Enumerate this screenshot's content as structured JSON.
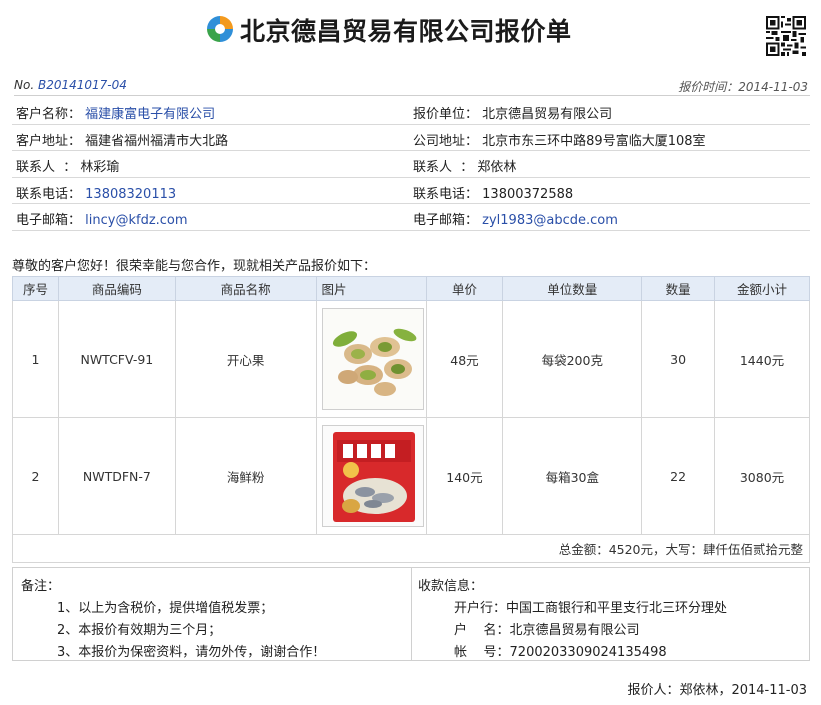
{
  "document": {
    "title": "北京德昌贸易有限公司报价单",
    "quote_no_label": "No.",
    "quote_no": "B20141017-04",
    "quote_date_label": "报价时间：",
    "quote_date": "2014-11-03"
  },
  "client": {
    "name_label": "客户名称：",
    "name": "福建康富电子有限公司",
    "address_label": "客户地址：",
    "address": "福建省福州福清市大北路",
    "contact_label": "联系人  ：",
    "contact": "林彩瑜",
    "phone_label": "联系电话：",
    "phone": "13808320113",
    "email_label": "电子邮箱：",
    "email": "lincy@kfdz.com"
  },
  "supplier": {
    "unit_label": "报价单位：",
    "unit": "北京德昌贸易有限公司",
    "address_label": "公司地址：",
    "address": "北京市东三环中路89号富临大厦108室",
    "contact_label": "联系人  ：",
    "contact": "郑依林",
    "phone_label": "联系电话：",
    "phone": "13800372588",
    "email_label": "电子邮箱：",
    "email": "zyl1983@abcde.com"
  },
  "greeting": "尊敬的客户您好！很荣幸能与您合作，现就相关产品报价如下：",
  "table": {
    "headers": [
      "序号",
      "商品编码",
      "商品名称",
      "图片",
      "单价",
      "单位数量",
      "数量",
      "金额小计"
    ],
    "rows": [
      {
        "no": "1",
        "code": "NWTCFV-91",
        "name": "开心果",
        "image": "pistachio-photo",
        "price": "48元",
        "unit_qty": "每袋200克",
        "qty": "30",
        "subtotal": "1440元"
      },
      {
        "no": "2",
        "code": "NWTDFN-7",
        "name": "海鲜粉",
        "image": "seafood-powder-package",
        "price": "140元",
        "unit_qty": "每箱30盒",
        "qty": "22",
        "subtotal": "3080元"
      }
    ],
    "total": "总金额：4520元，大写：肆仟伍佰贰拾元整"
  },
  "notes": {
    "label": "备注：",
    "lines": [
      "1、以上为含税价，提供增值税发票；",
      "2、本报价有效期为三个月；",
      "3、本报价为保密资料，请勿外传，谢谢合作！"
    ]
  },
  "bank": {
    "label": "收款信息：",
    "bank": "开户行：中国工商银行和平里支行北三环分理处",
    "account_name": "户    名：北京德昌贸易有限公司",
    "account_no": "帐    号：7200203309024135498"
  },
  "signature": "报价人：郑依林，2014-11-03",
  "colors": {
    "link_blue": "#2a4fa8",
    "header_bg": "#e4ecf7"
  }
}
